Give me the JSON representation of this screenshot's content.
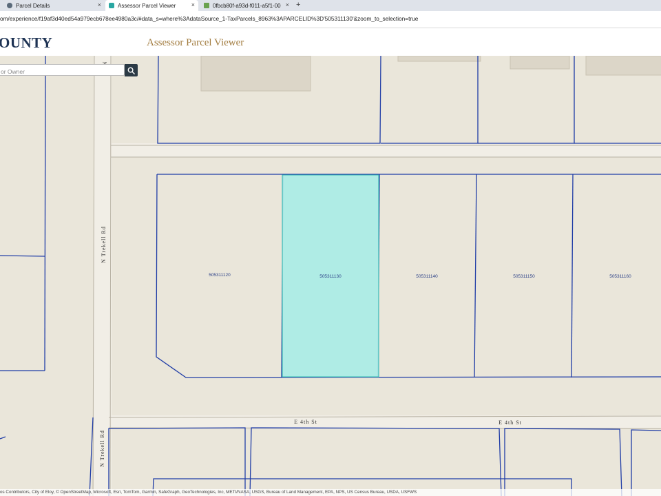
{
  "browser": {
    "tabs": [
      {
        "title": "Parcel Details",
        "active": false
      },
      {
        "title": "Assessor Parcel Viewer",
        "active": true
      },
      {
        "title": "0fbcb80f-a93d-f011-a5f1-00",
        "active": false
      }
    ],
    "new_tab_glyph": "+",
    "close_glyph": "×",
    "url": "om/experience/f19af3d40ed54a979ecb678ee4980a3c/#data_s=where%3AdataSource_1-TaxParcels_8963%3APARCELID%3D'505311130'&zoom_to_selection=true"
  },
  "app": {
    "brand": "OUNTY",
    "title": "Assessor Parcel Viewer"
  },
  "search": {
    "placeholder": "or Owner",
    "icon": "search-icon"
  },
  "map": {
    "parcels": [
      {
        "id": "505311120",
        "selected": false
      },
      {
        "id": "505311130",
        "selected": true
      },
      {
        "id": "505311140",
        "selected": false
      },
      {
        "id": "505311150",
        "selected": false
      },
      {
        "id": "505311160",
        "selected": false
      }
    ],
    "roads": {
      "street_left": "E 4th St",
      "street_right": "E 4th St",
      "trekell_mid": "N Trekell Rd",
      "trekell_low": "N Trekell Rd",
      "trekell_top": "N"
    },
    "colors": {
      "parcel_line": "#1f3ca6",
      "selected_fill": "#a8ece6",
      "background": "#eae6da",
      "building": "#dcd6c8"
    }
  },
  "attribution": "os Contributors, City of Eloy, © OpenStreetMap, Microsoft, Esri, TomTom, Garmin, SafeGraph, GeoTechnologies, Inc, METI/NASA, USGS, Bureau of Land Management, EPA, NPS, US Census Bureau, USDA, USFWS"
}
